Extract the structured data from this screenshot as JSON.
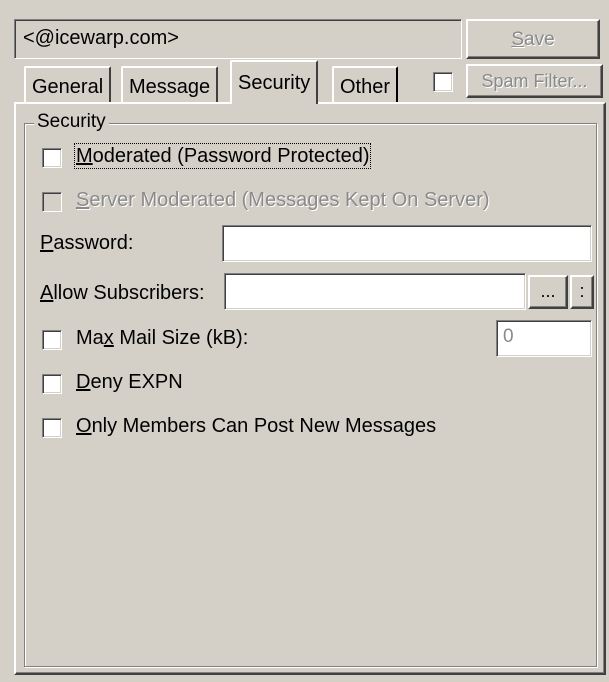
{
  "header": {
    "address_value": "<@icewarp.com>",
    "save_label": "Save",
    "save_access": "S",
    "save_rest": "ave",
    "spam_filter_label": "Spam Filter..."
  },
  "tabs": [
    {
      "label": "General",
      "active": false
    },
    {
      "label": "Message",
      "active": false
    },
    {
      "label": "Security",
      "active": true
    },
    {
      "label": "Other",
      "active": false
    }
  ],
  "security": {
    "group_title": "Security",
    "moderated": {
      "access": "M",
      "rest": "oderated (Password Protected)",
      "checked": false
    },
    "server_moderated": {
      "access": "S",
      "rest": "erver Moderated (Messages Kept On Server)",
      "checked": false,
      "disabled": true
    },
    "password": {
      "access": "P",
      "rest": "assword:",
      "value": ""
    },
    "allow_subscribers": {
      "access": "A",
      "rest": "llow Subscribers:",
      "value": "",
      "browse_label": "...",
      "extra_label": ":"
    },
    "max_mail_size": {
      "pre": "Ma",
      "access": "x",
      "rest": " Mail Size (kB):",
      "value": "0",
      "checked": false
    },
    "deny_expn": {
      "access": "D",
      "rest": "eny EXPN",
      "checked": false
    },
    "only_members": {
      "access": "O",
      "rest": "nly Members Can Post New Messages",
      "checked": false
    }
  }
}
